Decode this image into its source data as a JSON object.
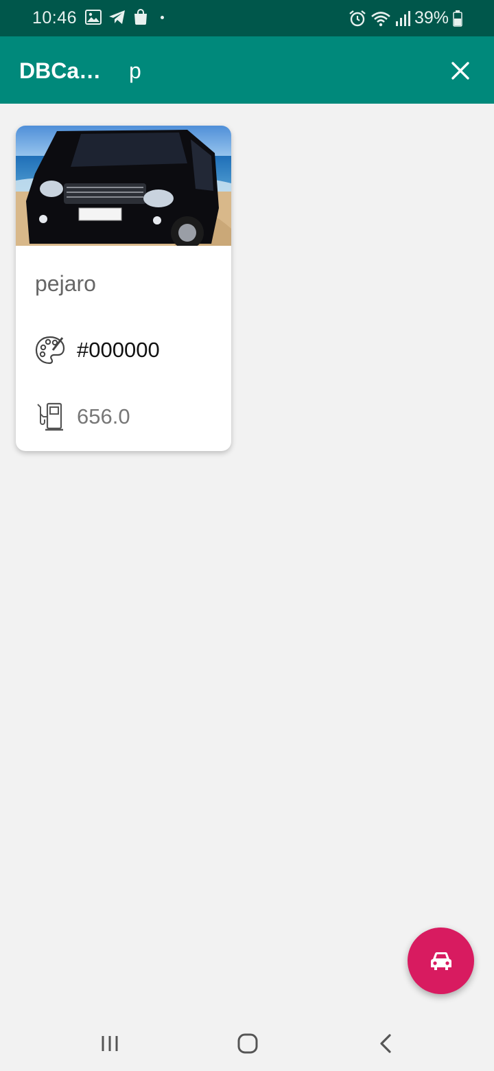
{
  "status_bar": {
    "time": "10:46",
    "battery": "39%",
    "icons_left": [
      "gallery-icon",
      "telegram-icon",
      "shopping-bag-icon"
    ],
    "icons_right": [
      "alarm-icon",
      "wifi-icon",
      "signal-icon",
      "battery-icon"
    ]
  },
  "app_bar": {
    "title": "DBCa…",
    "search_value": "p",
    "close_icon": "close-icon",
    "background": "#00897b",
    "status_background": "#00574b"
  },
  "cards": [
    {
      "name": "pejaro",
      "color_value": "#000000",
      "color_icon": "palette-icon",
      "fuel_value": "656.0",
      "fuel_icon": "fuel-pump-icon",
      "image": "car-photo"
    }
  ],
  "fab": {
    "icon": "car-icon",
    "background": "#d81b60"
  },
  "nav_bar": {
    "icons": [
      "recent-apps-icon",
      "home-icon",
      "back-icon"
    ]
  }
}
